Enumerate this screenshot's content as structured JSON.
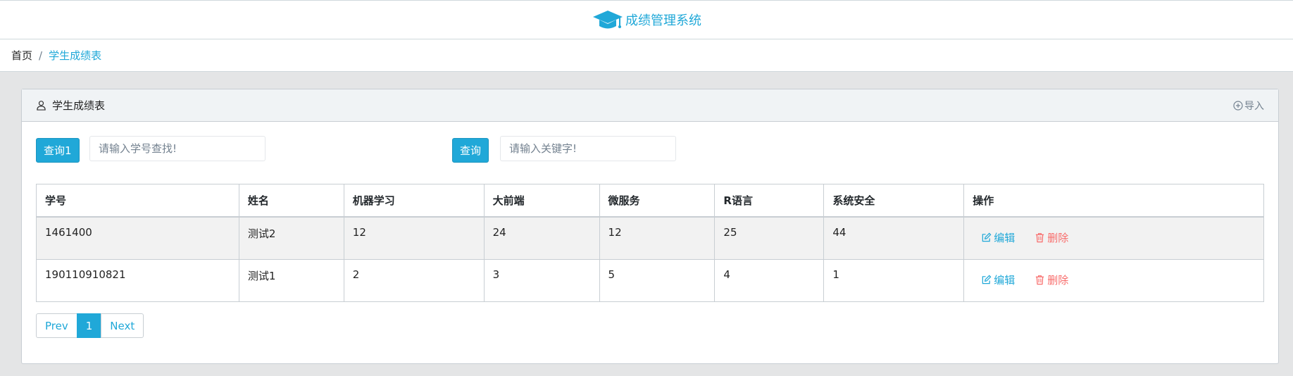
{
  "app": {
    "title": "成绩管理系统"
  },
  "breadcrumb": {
    "home": "首页",
    "separator": "/",
    "current": "学生成绩表"
  },
  "card": {
    "title": "学生成绩表",
    "import_label": "导入"
  },
  "search": {
    "button1_label": "查询1",
    "input1_placeholder": "请输入学号查找!",
    "button2_label": "查询",
    "input2_placeholder": "请输入关键字!"
  },
  "table": {
    "headers": [
      "学号",
      "姓名",
      "机器学习",
      "大前端",
      "微服务",
      "R语言",
      "系统安全",
      "操作"
    ],
    "rows": [
      [
        "1461400",
        "测试2",
        "12",
        "24",
        "12",
        "25",
        "44"
      ],
      [
        "190110910821",
        "测试1",
        "2",
        "3",
        "5",
        "4",
        "1"
      ]
    ],
    "edit_label": "编辑",
    "delete_label": "删除"
  },
  "pagination": {
    "prev": "Prev",
    "current": "1",
    "next": "Next"
  },
  "colors": {
    "accent": "#20a8d8",
    "danger": "#f86c6b"
  }
}
